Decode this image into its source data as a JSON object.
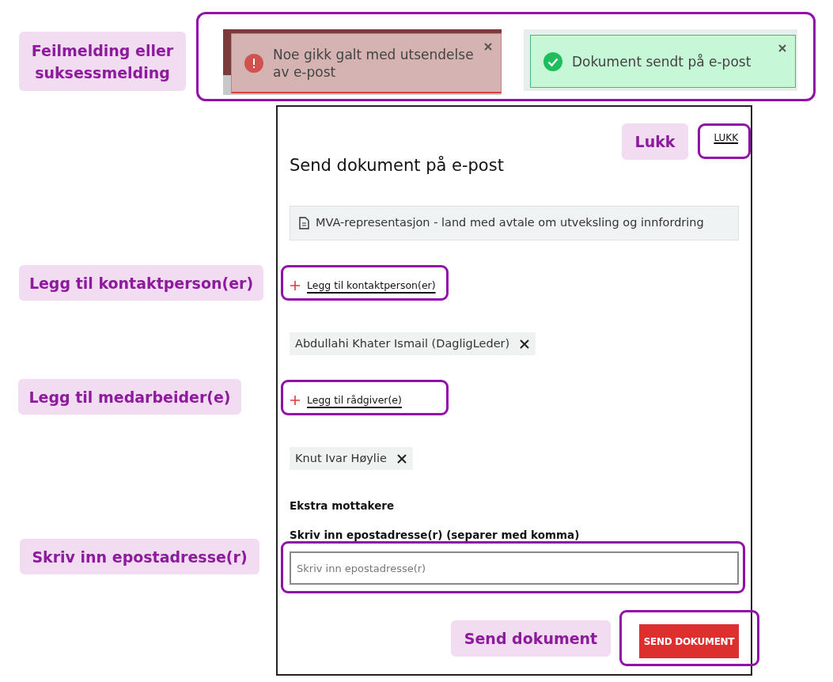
{
  "callouts": [
    {
      "text": "Feilmelding eller suksessmelding"
    },
    {
      "text": "Lukk"
    },
    {
      "text": "Legg til kontaktperson(er)"
    },
    {
      "text": "Legg til medarbeider(e)"
    },
    {
      "text": "Skriv inn epostadresse(r)"
    },
    {
      "text": "Send dokument"
    }
  ],
  "toasts": [
    {
      "kind": "error",
      "message": "Noe gikk galt med utsendelse av e-post"
    },
    {
      "kind": "success",
      "message": "Dokument sendt på e-post"
    }
  ],
  "dialog": {
    "close_link": "LUKK",
    "title": "Send dokument på e-post",
    "document": "MVA-representasjon - land med avtale om utveksling og innfordring",
    "contact_add": "Legg til kontaktperson(er)",
    "contacts": [
      {
        "name": "Abdullahi Khater Ismail (DagligLeder)"
      }
    ],
    "advisor_add": "Legg til rådgiver(e)",
    "advisors": [
      {
        "name": "Knut Ivar Høylie"
      }
    ],
    "extra_heading": "Ekstra mottakere",
    "email_label": "Skriv inn epostadresse(r) (separer med komma)",
    "email_placeholder": "Skriv inn epostadresse(r)",
    "send_button": "SEND DOKUMENT"
  }
}
